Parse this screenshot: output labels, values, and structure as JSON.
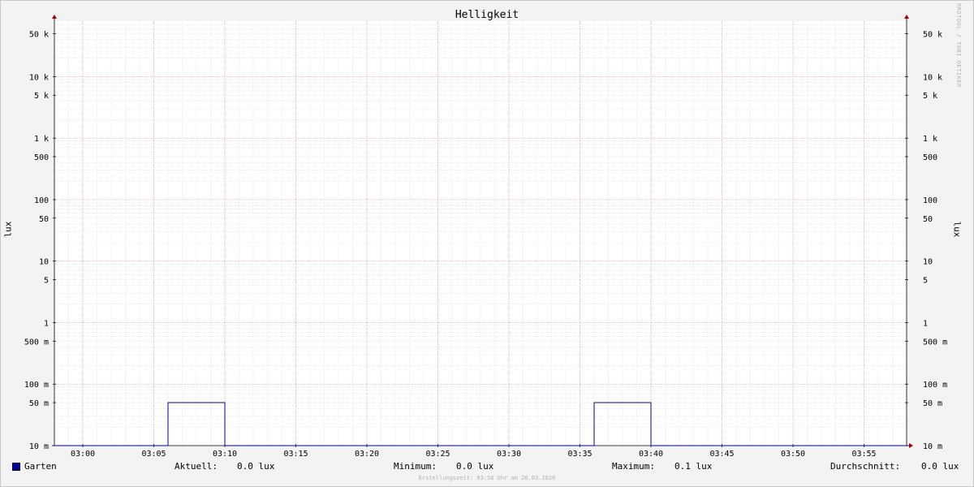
{
  "chart_data": {
    "type": "line",
    "title": "Helligkeit",
    "ylabel": "lux",
    "ylabel_right": "lux",
    "yscale": "log",
    "ylim": [
      0.01,
      80000
    ],
    "xlim": [
      "02:58",
      "03:58"
    ],
    "x_ticks": [
      "03:00",
      "03:05",
      "03:10",
      "03:15",
      "03:20",
      "03:25",
      "03:30",
      "03:35",
      "03:40",
      "03:45",
      "03:50",
      "03:55"
    ],
    "y_ticks": [
      {
        "value": 50000,
        "label": "50 k"
      },
      {
        "value": 10000,
        "label": "10 k"
      },
      {
        "value": 5000,
        "label": "5 k"
      },
      {
        "value": 1000,
        "label": "1 k"
      },
      {
        "value": 500,
        "label": "500"
      },
      {
        "value": 100,
        "label": "100"
      },
      {
        "value": 50,
        "label": "50"
      },
      {
        "value": 10,
        "label": "10"
      },
      {
        "value": 5,
        "label": "5"
      },
      {
        "value": 1,
        "label": "1"
      },
      {
        "value": 0.5,
        "label": "500 m"
      },
      {
        "value": 0.1,
        "label": "100 m"
      },
      {
        "value": 0.05,
        "label": "50 m"
      },
      {
        "value": 0.01,
        "label": "10 m"
      }
    ],
    "series": [
      {
        "name": "Garten",
        "color": "#0000a0",
        "points": [
          [
            "02:58",
            0.01
          ],
          [
            "03:06",
            0.01
          ],
          [
            "03:06",
            0.05
          ],
          [
            "03:10",
            0.05
          ],
          [
            "03:10",
            0.01
          ],
          [
            "03:36",
            0.01
          ],
          [
            "03:36",
            0.05
          ],
          [
            "03:40",
            0.05
          ],
          [
            "03:40",
            0.01
          ],
          [
            "03:58",
            0.01
          ]
        ]
      }
    ],
    "grid": true,
    "watermark": "RRDTOOL / TOBI OETIKER"
  },
  "legend": {
    "series_name": "Garten",
    "aktuell_label": "Aktuell:",
    "aktuell_value": "0.0 lux",
    "minimum_label": "Minimum:",
    "minimum_value": "0.0 lux",
    "maximum_label": "Maximum:",
    "maximum_value": "0.1 lux",
    "durchschnitt_label": "Durchschnitt:",
    "durchschnitt_value": "0.0 lux"
  },
  "footer": "Erstellungszeit: 03:58 Uhr am 26.03.2026"
}
